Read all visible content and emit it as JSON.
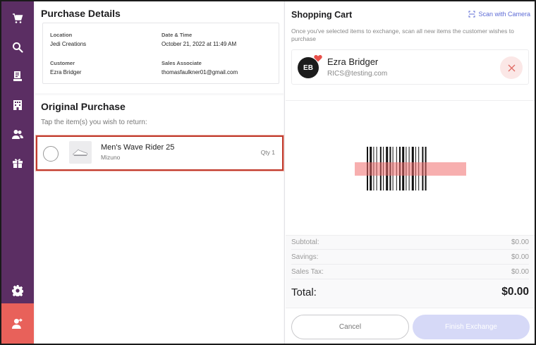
{
  "sidebar": {
    "icons": [
      "cart-icon",
      "search-icon",
      "receipt-icon",
      "building-icon",
      "people-icon",
      "gift-icon",
      "gear-icon",
      "user-switch-icon"
    ]
  },
  "purchase_details": {
    "title": "Purchase Details",
    "location_label": "Location",
    "location_value": "Jedi Creations",
    "datetime_label": "Date & Time",
    "datetime_value": "October 21, 2022 at 11:49 AM",
    "customer_label": "Customer",
    "customer_value": "Ezra Bridger",
    "associate_label": "Sales Associate",
    "associate_value": "thomasfaulkner01@gmail.com"
  },
  "original_purchase": {
    "title": "Original Purchase",
    "hint": "Tap the item(s) you wish to return:",
    "items": [
      {
        "name": "Men's Wave Rider 25",
        "brand": "Mizuno",
        "qty": "Qty 1",
        "selected": false
      }
    ]
  },
  "shopping_cart": {
    "title": "Shopping Cart",
    "scan_label": "Scan with Camera",
    "description": "Once you've selected items to exchange, scan all new items the customer wishes to purchase",
    "customer": {
      "initials": "EB",
      "name": "Ezra Bridger",
      "email": "RICS@testing.com"
    }
  },
  "totals": {
    "subtotal_label": "Subtotal:",
    "subtotal_value": "$0.00",
    "savings_label": "Savings:",
    "savings_value": "$0.00",
    "tax_label": "Sales Tax:",
    "tax_value": "$0.00",
    "total_label": "Total:",
    "total_value": "$0.00"
  },
  "actions": {
    "cancel_label": "Cancel",
    "finish_label": "Finish Exchange"
  },
  "colors": {
    "sidebar": "#5b2e63",
    "sidebar_active": "#e8615a",
    "accent": "#5d6bd6",
    "highlight_border": "#c0392b",
    "finish_disabled": "#d6d9f7"
  }
}
